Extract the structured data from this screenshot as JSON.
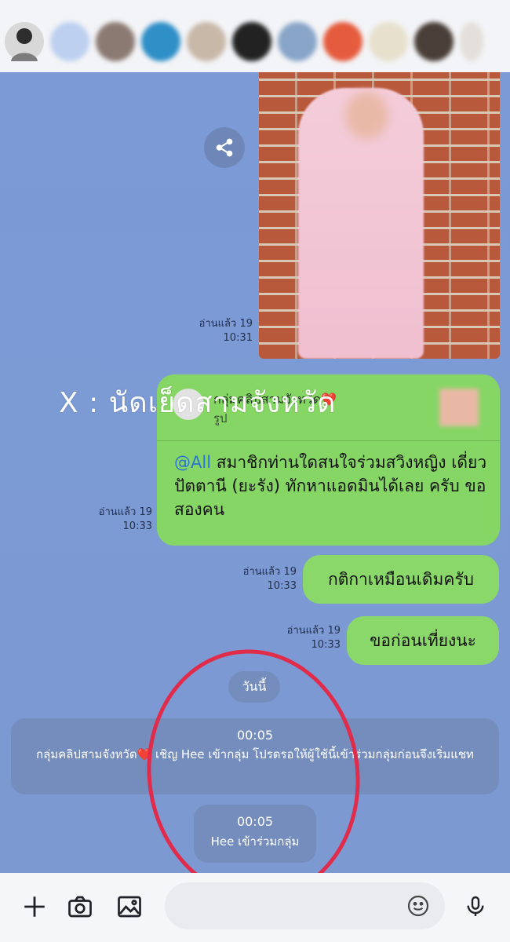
{
  "chat": {
    "photo_read": "อ่านแล้ว 19",
    "photo_time": "10:31",
    "watermark": "X : นัดเย็ดสามจังหวัด",
    "reply": {
      "sender": "กลุ่มคลิปสามจังหวัด❤️",
      "quoted_type": "รูป",
      "mention": "@All",
      "text": "สมาชิกท่านใดสนใจร่วมสวิงหญิง เดี่ยวปัตตานี (ยะรัง) ทักหาแอดมินได้เลย ครับ ขอสองคน",
      "read": "อ่านแล้ว 19",
      "time": "10:33"
    },
    "messages": [
      {
        "text": "กติกาเหมือนเดิมครับ",
        "read": "อ่านแล้ว 19",
        "time": "10:33"
      },
      {
        "text": "ขอก่อนเที่ยงนะ",
        "read": "อ่านแล้ว 19",
        "time": "10:33"
      }
    ],
    "day_label": "วันนี้",
    "system": [
      {
        "time": "00:05",
        "text": "กลุ่มคลิปสามจังหวัด❤️ เชิญ Hee เข้ากลุ่ม โปรดรอให้ผู้ใช้นี้เข้าร่วมกลุ่มก่อนจึงเริ่มแชท"
      },
      {
        "time": "00:05",
        "text": "Hee เข้าร่วมกลุ่ม"
      }
    ]
  },
  "colors": {
    "chat_bg": "#7d9ad4",
    "bubble_green": "#8bd86a",
    "annotation_red": "#e02b4a"
  },
  "icons": [
    "share-icon",
    "plus-icon",
    "camera-icon",
    "image-icon",
    "emoji-icon",
    "mic-icon"
  ]
}
